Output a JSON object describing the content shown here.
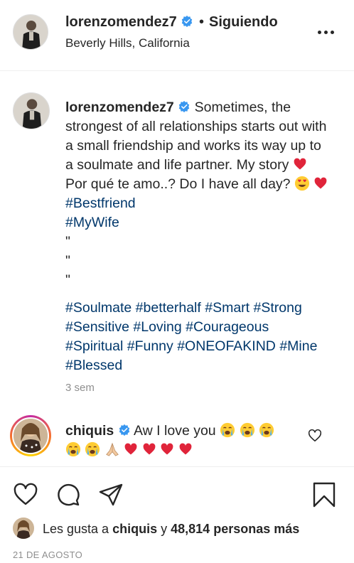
{
  "header": {
    "username": "lorenzomendez7",
    "separator": "•",
    "follow_status": "Siguiendo",
    "location": "Beverly Hills, California",
    "more_icon": "more-horizontal-icon"
  },
  "caption": {
    "username": "lorenzomendez7",
    "text_1": "Sometimes, the strongest of all relationships starts out with a small friendship and works its way up to a soulmate and life partner. My story",
    "text_2": "Por qué te amo..? Do I have all day?",
    "tag_bestfriend": "#Bestfriend",
    "tag_mywife": "#MyWife",
    "quotes": [
      "\"",
      "\"",
      "\""
    ],
    "tags": [
      "#Soulmate",
      "#betterhalf",
      "#Smart",
      "#Strong",
      "#Sensitive",
      "#Loving",
      "#Courageous",
      "#Spiritual",
      "#Funny",
      "#ONEOFAKIND",
      "#Mine",
      "#Blessed"
    ],
    "time": "3 sem"
  },
  "comment": {
    "username": "chiquis",
    "text": "Aw I love you"
  },
  "likes": {
    "prefix": "Les gusta a",
    "liked_by": "chiquis",
    "middle": "y",
    "count": "48,814 personas más"
  },
  "date": "21 DE AGOSTO",
  "colors": {
    "text": "#262626",
    "secondary": "#8e8e8e",
    "hashtag": "#00376b",
    "verified": "#3897f0",
    "heart": "#ed4956"
  }
}
